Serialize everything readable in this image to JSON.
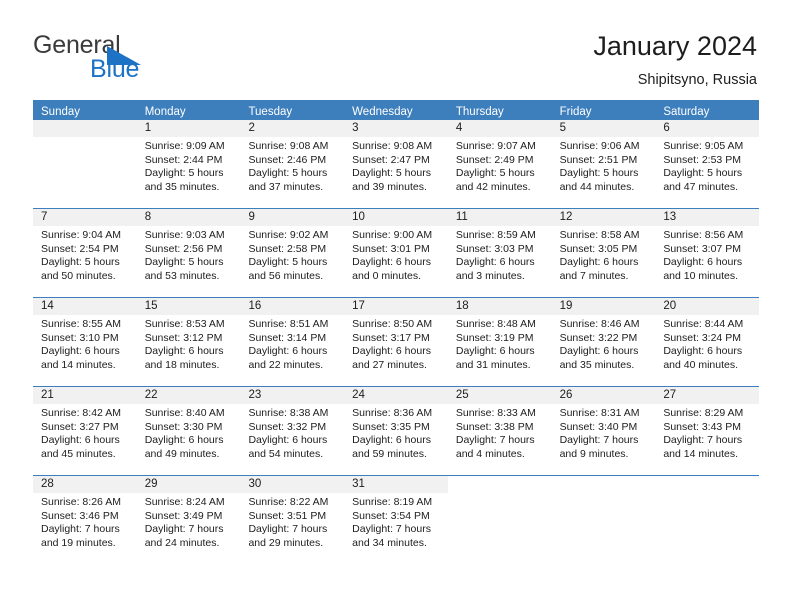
{
  "brand": {
    "name_part1": "General",
    "name_part2": "Blue",
    "triangle_color": "#1c72c4"
  },
  "header": {
    "month_title": "January 2024",
    "location": "Shipitsyno, Russia"
  },
  "calendar": {
    "header_color": "#3d7ebd",
    "weekdays": [
      "Sunday",
      "Monday",
      "Tuesday",
      "Wednesday",
      "Thursday",
      "Friday",
      "Saturday"
    ],
    "labels": {
      "sunrise": "Sunrise:",
      "sunset": "Sunset:",
      "daylight": "Daylight:"
    },
    "weeks": [
      [
        {
          "day": "",
          "empty": true
        },
        {
          "day": "1",
          "sunrise": "Sunrise: 9:09 AM",
          "sunset": "Sunset: 2:44 PM",
          "daylight_line1": "Daylight: 5 hours",
          "daylight_line2": "and 35 minutes."
        },
        {
          "day": "2",
          "sunrise": "Sunrise: 9:08 AM",
          "sunset": "Sunset: 2:46 PM",
          "daylight_line1": "Daylight: 5 hours",
          "daylight_line2": "and 37 minutes."
        },
        {
          "day": "3",
          "sunrise": "Sunrise: 9:08 AM",
          "sunset": "Sunset: 2:47 PM",
          "daylight_line1": "Daylight: 5 hours",
          "daylight_line2": "and 39 minutes."
        },
        {
          "day": "4",
          "sunrise": "Sunrise: 9:07 AM",
          "sunset": "Sunset: 2:49 PM",
          "daylight_line1": "Daylight: 5 hours",
          "daylight_line2": "and 42 minutes."
        },
        {
          "day": "5",
          "sunrise": "Sunrise: 9:06 AM",
          "sunset": "Sunset: 2:51 PM",
          "daylight_line1": "Daylight: 5 hours",
          "daylight_line2": "and 44 minutes."
        },
        {
          "day": "6",
          "sunrise": "Sunrise: 9:05 AM",
          "sunset": "Sunset: 2:53 PM",
          "daylight_line1": "Daylight: 5 hours",
          "daylight_line2": "and 47 minutes."
        }
      ],
      [
        {
          "day": "7",
          "sunrise": "Sunrise: 9:04 AM",
          "sunset": "Sunset: 2:54 PM",
          "daylight_line1": "Daylight: 5 hours",
          "daylight_line2": "and 50 minutes."
        },
        {
          "day": "8",
          "sunrise": "Sunrise: 9:03 AM",
          "sunset": "Sunset: 2:56 PM",
          "daylight_line1": "Daylight: 5 hours",
          "daylight_line2": "and 53 minutes."
        },
        {
          "day": "9",
          "sunrise": "Sunrise: 9:02 AM",
          "sunset": "Sunset: 2:58 PM",
          "daylight_line1": "Daylight: 5 hours",
          "daylight_line2": "and 56 minutes."
        },
        {
          "day": "10",
          "sunrise": "Sunrise: 9:00 AM",
          "sunset": "Sunset: 3:01 PM",
          "daylight_line1": "Daylight: 6 hours",
          "daylight_line2": "and 0 minutes."
        },
        {
          "day": "11",
          "sunrise": "Sunrise: 8:59 AM",
          "sunset": "Sunset: 3:03 PM",
          "daylight_line1": "Daylight: 6 hours",
          "daylight_line2": "and 3 minutes."
        },
        {
          "day": "12",
          "sunrise": "Sunrise: 8:58 AM",
          "sunset": "Sunset: 3:05 PM",
          "daylight_line1": "Daylight: 6 hours",
          "daylight_line2": "and 7 minutes."
        },
        {
          "day": "13",
          "sunrise": "Sunrise: 8:56 AM",
          "sunset": "Sunset: 3:07 PM",
          "daylight_line1": "Daylight: 6 hours",
          "daylight_line2": "and 10 minutes."
        }
      ],
      [
        {
          "day": "14",
          "sunrise": "Sunrise: 8:55 AM",
          "sunset": "Sunset: 3:10 PM",
          "daylight_line1": "Daylight: 6 hours",
          "daylight_line2": "and 14 minutes."
        },
        {
          "day": "15",
          "sunrise": "Sunrise: 8:53 AM",
          "sunset": "Sunset: 3:12 PM",
          "daylight_line1": "Daylight: 6 hours",
          "daylight_line2": "and 18 minutes."
        },
        {
          "day": "16",
          "sunrise": "Sunrise: 8:51 AM",
          "sunset": "Sunset: 3:14 PM",
          "daylight_line1": "Daylight: 6 hours",
          "daylight_line2": "and 22 minutes."
        },
        {
          "day": "17",
          "sunrise": "Sunrise: 8:50 AM",
          "sunset": "Sunset: 3:17 PM",
          "daylight_line1": "Daylight: 6 hours",
          "daylight_line2": "and 27 minutes."
        },
        {
          "day": "18",
          "sunrise": "Sunrise: 8:48 AM",
          "sunset": "Sunset: 3:19 PM",
          "daylight_line1": "Daylight: 6 hours",
          "daylight_line2": "and 31 minutes."
        },
        {
          "day": "19",
          "sunrise": "Sunrise: 8:46 AM",
          "sunset": "Sunset: 3:22 PM",
          "daylight_line1": "Daylight: 6 hours",
          "daylight_line2": "and 35 minutes."
        },
        {
          "day": "20",
          "sunrise": "Sunrise: 8:44 AM",
          "sunset": "Sunset: 3:24 PM",
          "daylight_line1": "Daylight: 6 hours",
          "daylight_line2": "and 40 minutes."
        }
      ],
      [
        {
          "day": "21",
          "sunrise": "Sunrise: 8:42 AM",
          "sunset": "Sunset: 3:27 PM",
          "daylight_line1": "Daylight: 6 hours",
          "daylight_line2": "and 45 minutes."
        },
        {
          "day": "22",
          "sunrise": "Sunrise: 8:40 AM",
          "sunset": "Sunset: 3:30 PM",
          "daylight_line1": "Daylight: 6 hours",
          "daylight_line2": "and 49 minutes."
        },
        {
          "day": "23",
          "sunrise": "Sunrise: 8:38 AM",
          "sunset": "Sunset: 3:32 PM",
          "daylight_line1": "Daylight: 6 hours",
          "daylight_line2": "and 54 minutes."
        },
        {
          "day": "24",
          "sunrise": "Sunrise: 8:36 AM",
          "sunset": "Sunset: 3:35 PM",
          "daylight_line1": "Daylight: 6 hours",
          "daylight_line2": "and 59 minutes."
        },
        {
          "day": "25",
          "sunrise": "Sunrise: 8:33 AM",
          "sunset": "Sunset: 3:38 PM",
          "daylight_line1": "Daylight: 7 hours",
          "daylight_line2": "and 4 minutes."
        },
        {
          "day": "26",
          "sunrise": "Sunrise: 8:31 AM",
          "sunset": "Sunset: 3:40 PM",
          "daylight_line1": "Daylight: 7 hours",
          "daylight_line2": "and 9 minutes."
        },
        {
          "day": "27",
          "sunrise": "Sunrise: 8:29 AM",
          "sunset": "Sunset: 3:43 PM",
          "daylight_line1": "Daylight: 7 hours",
          "daylight_line2": "and 14 minutes."
        }
      ],
      [
        {
          "day": "28",
          "sunrise": "Sunrise: 8:26 AM",
          "sunset": "Sunset: 3:46 PM",
          "daylight_line1": "Daylight: 7 hours",
          "daylight_line2": "and 19 minutes."
        },
        {
          "day": "29",
          "sunrise": "Sunrise: 8:24 AM",
          "sunset": "Sunset: 3:49 PM",
          "daylight_line1": "Daylight: 7 hours",
          "daylight_line2": "and 24 minutes."
        },
        {
          "day": "30",
          "sunrise": "Sunrise: 8:22 AM",
          "sunset": "Sunset: 3:51 PM",
          "daylight_line1": "Daylight: 7 hours",
          "daylight_line2": "and 29 minutes."
        },
        {
          "day": "31",
          "sunrise": "Sunrise: 8:19 AM",
          "sunset": "Sunset: 3:54 PM",
          "daylight_line1": "Daylight: 7 hours",
          "daylight_line2": "and 34 minutes."
        },
        {
          "day": "",
          "empty": true,
          "blank": true
        },
        {
          "day": "",
          "empty": true,
          "blank": true
        },
        {
          "day": "",
          "empty": true,
          "blank": true
        }
      ]
    ]
  }
}
